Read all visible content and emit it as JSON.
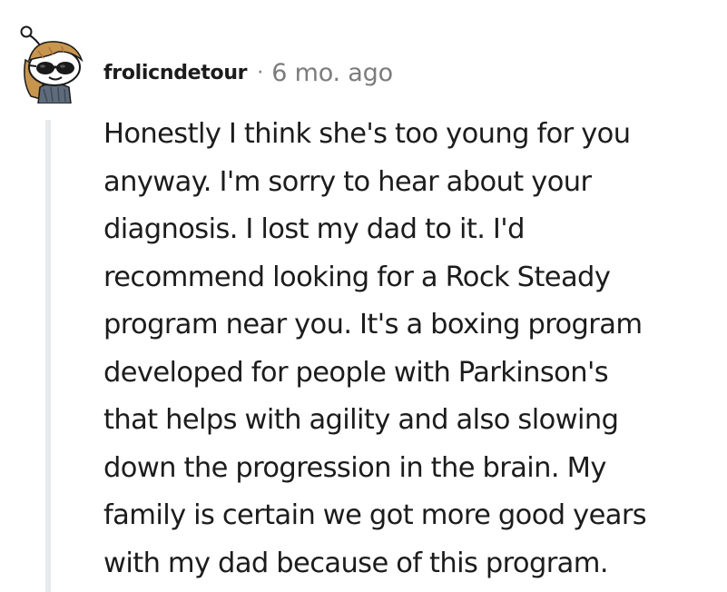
{
  "comment": {
    "username": "frolicndetour",
    "separator": "·",
    "timestamp": "6 mo. ago",
    "body_lines": [
      "Honestly I think she's too young for you",
      "anyway. I'm sorry to hear about your",
      "diagnosis. I lost my dad to it. I'd",
      "recommend looking for a Rock Steady",
      "program near you. It's a boxing program",
      "developed for people with Parkinson's",
      "that helps with agility and also slowing",
      "down the progression in the brain. My",
      "family is certain we got more good years",
      "with my dad because of this program."
    ]
  },
  "avatar": {
    "icon": "snoo-avatar-sunglasses-icon",
    "hair_color": "#c8954f",
    "glasses_color": "#1a1a1a",
    "scarf_color": "#5d6b7a"
  },
  "colors": {
    "text": "#1c1c1c",
    "muted": "#7c7c7c",
    "thread_line": "#e8e9ea"
  }
}
